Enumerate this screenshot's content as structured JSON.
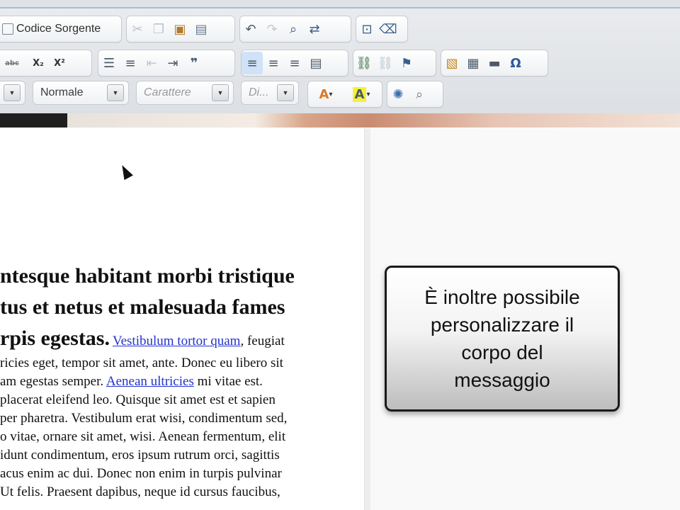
{
  "toolbar": {
    "source_button_label": "Codice Sorgente",
    "format_select": "Normale",
    "font_select_placeholder": "Carattere",
    "size_select_placeholder": "Di...",
    "text_color_label": "A",
    "bg_color_label": "A",
    "subscript_label": "X₂",
    "superscript_label": "X²",
    "strike_label": "abc",
    "omega_label": "Ω"
  },
  "article": {
    "heading_lines": [
      "ntesque habitant morbi tristique",
      "tus et netus et malesuada fames",
      "rpis egestas."
    ],
    "line1_link": "Vestibulum tortor quam",
    "line1_after": ", feugiat",
    "lines": [
      "ricies eget, tempor sit amet, ante. Donec eu libero sit"
    ],
    "line3_before": "am egestas semper. ",
    "line3_link": "Aenean ultricies",
    "line3_after": " mi vitae est.",
    "lines_rest": [
      "placerat eleifend leo. Quisque sit amet est et sapien",
      "per pharetra. Vestibulum erat wisi, condimentum sed,",
      "o vitae, ornare sit amet, wisi. Aenean fermentum, elit",
      "idunt condimentum, eros ipsum rutrum orci, sagittis",
      "acus enim ac dui. Donec non enim in turpis pulvinar",
      "Ut felis. Praesent dapibus, neque id cursus faucibus,"
    ]
  },
  "tip": {
    "line1": "È inoltre possibile",
    "line2": "personalizzare il",
    "line3": "corpo del",
    "line4": "messaggio"
  }
}
